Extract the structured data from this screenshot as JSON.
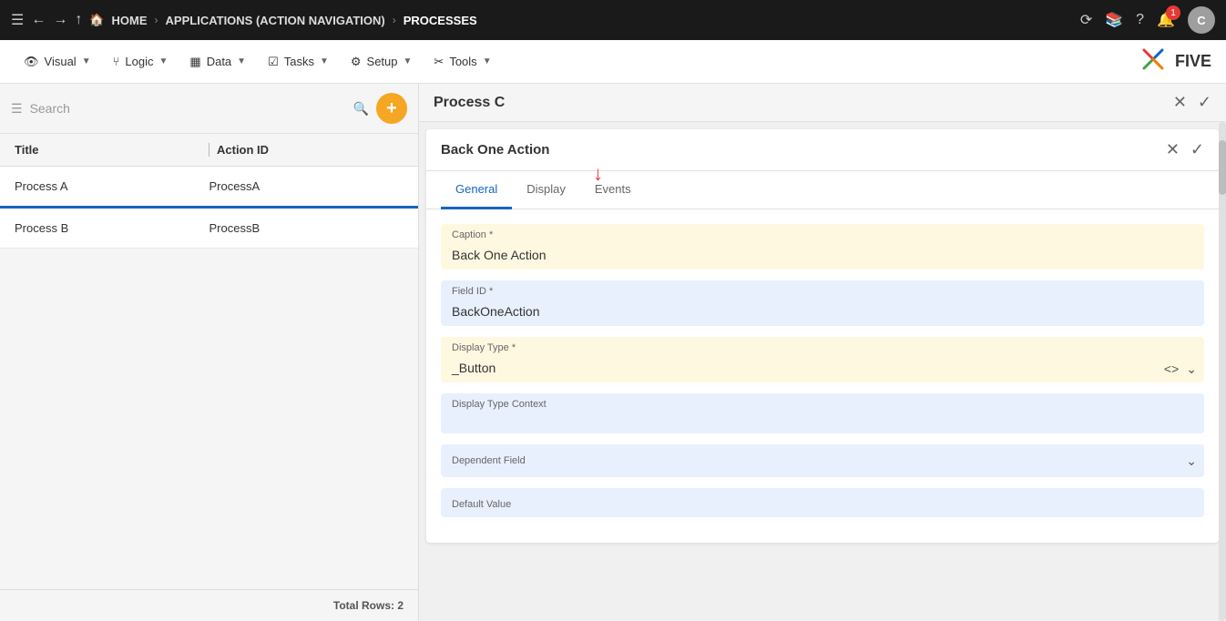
{
  "topnav": {
    "hamburger": "☰",
    "back": "←",
    "forward": "→",
    "up": "↑",
    "home_label": "HOME",
    "applications_label": "APPLICATIONS (ACTION NAVIGATION)",
    "processes_label": "PROCESSES",
    "notification_count": "1",
    "avatar_letter": "C"
  },
  "menubar": {
    "items": [
      {
        "icon": "👁",
        "label": "Visual",
        "id": "visual"
      },
      {
        "icon": "⑂",
        "label": "Logic",
        "id": "logic"
      },
      {
        "icon": "▦",
        "label": "Data",
        "id": "data"
      },
      {
        "icon": "☑",
        "label": "Tasks",
        "id": "tasks"
      },
      {
        "icon": "⚙",
        "label": "Setup",
        "id": "setup"
      },
      {
        "icon": "✂",
        "label": "Tools",
        "id": "tools"
      }
    ],
    "logo_text": "FIVE"
  },
  "sidebar": {
    "search_placeholder": "Search",
    "add_button_label": "+",
    "columns": [
      {
        "id": "title",
        "label": "Title"
      },
      {
        "id": "action_id",
        "label": "Action ID"
      }
    ],
    "rows": [
      {
        "title": "Process A",
        "action_id": "ProcessA",
        "selected": true
      },
      {
        "title": "Process B",
        "action_id": "ProcessB",
        "selected": false
      }
    ],
    "footer": "Total Rows: 2"
  },
  "process_panel": {
    "title": "Process C",
    "close_icon": "✕",
    "check_icon": "✓"
  },
  "back_one_action_panel": {
    "title": "Back One Action",
    "close_icon": "✕",
    "check_icon": "✓",
    "tabs": [
      {
        "id": "general",
        "label": "General",
        "active": true
      },
      {
        "id": "display",
        "label": "Display",
        "active": false
      },
      {
        "id": "events",
        "label": "Events",
        "active": false
      }
    ],
    "form": {
      "caption_label": "Caption *",
      "caption_value": "Back One Action",
      "field_id_label": "Field ID *",
      "field_id_value": "BackOneAction",
      "display_type_label": "Display Type *",
      "display_type_value": "_Button",
      "display_type_context_label": "Display Type Context",
      "display_type_context_value": "",
      "dependent_field_label": "Dependent Field",
      "dependent_field_value": "",
      "default_value_label": "Default Value",
      "default_value_value": ""
    }
  }
}
